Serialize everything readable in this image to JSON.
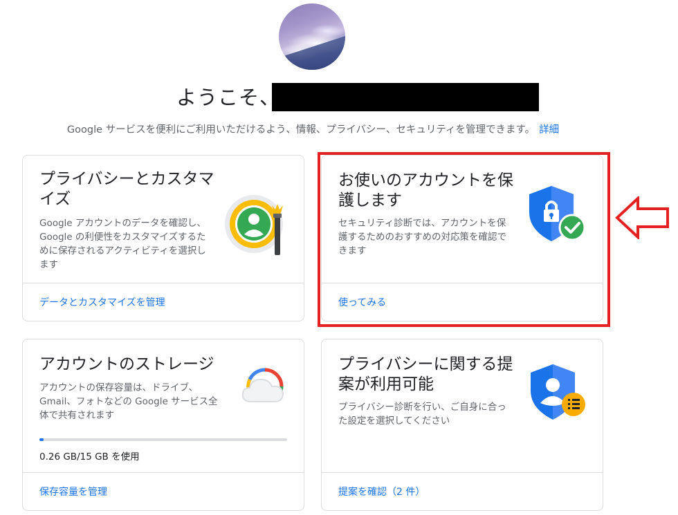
{
  "header": {
    "welcome_prefix": "ようこそ、",
    "subtitle": "Google サービスを便利にご利用いただけるよう、情報、プライバシー、セキュリティを管理できます。",
    "subtitle_link": "詳細"
  },
  "cards": {
    "privacy": {
      "title": "プライバシーとカスタマイズ",
      "description": "Google アカウントのデータを確認し、Google の利便性をカスタマイズするために保存されるアクティビティを選択します",
      "link": "データとカスタマイズを管理",
      "icon": "privacy-personalization-icon"
    },
    "security": {
      "title": "お使いのアカウントを保護します",
      "description": "セキュリティ診断では、アカウントを保護するためのおすすめの対応策を確認できます",
      "link": "使ってみる",
      "icon": "shield-lock-check-icon"
    },
    "storage": {
      "title": "アカウントのストレージ",
      "description": "アカウントの保存容量は、ドライブ、Gmail、フォトなどの Google サービス全体で共有されます",
      "usage": "0.26 GB/15 GB を使用",
      "usage_fraction": 0.017,
      "link": "保存容量を管理",
      "icon": "cloud-storage-icon"
    },
    "privacy_suggestions": {
      "title": "プライバシーに関する提案が利用可能",
      "description": "プライバシー診断を行い、ご自身に合った設定を選択してください",
      "link": "提案を確認（2 件）",
      "icon": "shield-person-list-icon"
    }
  },
  "colors": {
    "link": "#1a73e8",
    "highlight": "#e52020",
    "google_blue": "#1a73e8",
    "google_green": "#34a853",
    "google_yellow": "#fbbc04",
    "google_red": "#ea4335"
  }
}
